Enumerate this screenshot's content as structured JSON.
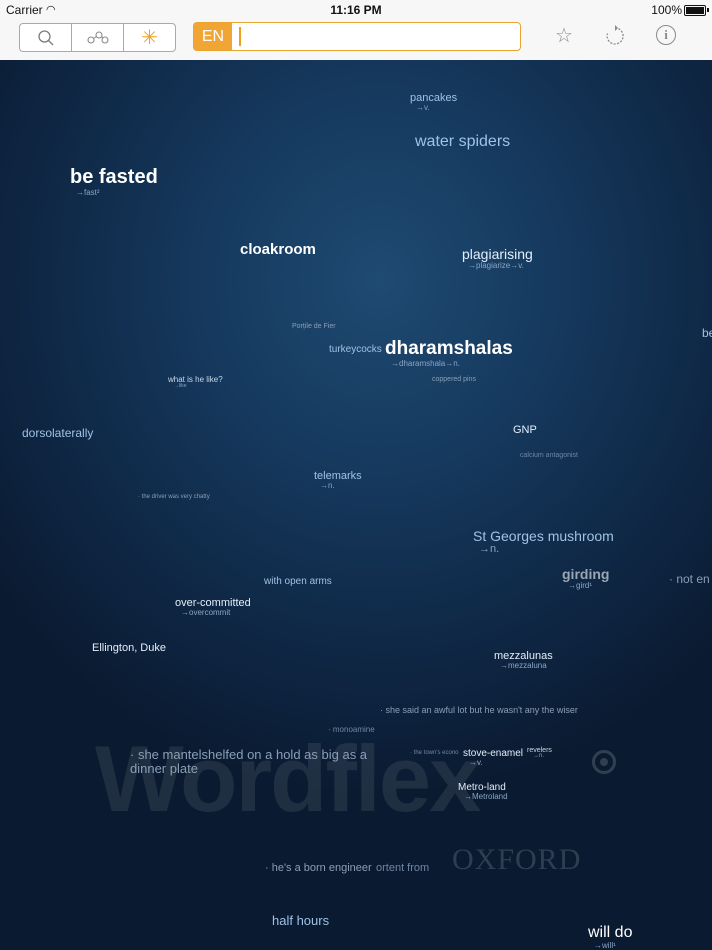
{
  "status_bar": {
    "carrier": "Carrier",
    "time": "11:16 PM",
    "battery": "100%"
  },
  "toolbar": {
    "language": "EN",
    "search_value": "",
    "icons": [
      "search-icon",
      "network-icon",
      "asterisk-icon",
      "star-icon",
      "refresh-icon",
      "info-icon"
    ],
    "accent_color": "#f0a535"
  },
  "word_cloud": {
    "words": [
      {
        "text": "pancakes",
        "sub": "→v."
      },
      {
        "text": "water spiders",
        "sub": ""
      },
      {
        "text": "be fasted",
        "sub": "→fast²"
      },
      {
        "text": "cloakroom",
        "sub": ""
      },
      {
        "text": "plagiarising",
        "sub": "→plagiarize→v."
      },
      {
        "text": "Porțile de Fier",
        "sub": ""
      },
      {
        "text": "turkeycocks",
        "sub": ""
      },
      {
        "text": "dharamshalas",
        "sub": "→dharamshala→n."
      },
      {
        "text": "be",
        "sub": ""
      },
      {
        "text": "what is he like?",
        "sub": "→like"
      },
      {
        "text": "coppered pins",
        "sub": ""
      },
      {
        "text": "dorsolaterally",
        "sub": ""
      },
      {
        "text": "GNP",
        "sub": ""
      },
      {
        "text": "calcium antagonist",
        "sub": ""
      },
      {
        "text": "telemarks",
        "sub": "→n."
      },
      {
        "text": "· the driver was very chatty",
        "sub": ""
      },
      {
        "text": "St Georges mushroom",
        "sub": "→n."
      },
      {
        "text": "girding",
        "sub": "→gird¹"
      },
      {
        "text": "· not en",
        "sub": ""
      },
      {
        "text": "with open arms",
        "sub": ""
      },
      {
        "text": "over-committed",
        "sub": "→overcommit"
      },
      {
        "text": "Ellington, Duke",
        "sub": ""
      },
      {
        "text": "mezzalunas",
        "sub": "→mezzaluna"
      },
      {
        "text": "· she said an awful lot but he wasn't any the wiser",
        "sub": ""
      },
      {
        "text": "· monoamine",
        "sub": ""
      },
      {
        "text": "· she mantelshelfed on a hold as big as a dinner plate",
        "sub": ""
      },
      {
        "text": "· the town's econo",
        "sub": ""
      },
      {
        "text": "stove-enamel",
        "sub": "→v."
      },
      {
        "text": "revelers",
        "sub": "→n."
      },
      {
        "text": "Metro-land",
        "sub": "→Metroland"
      },
      {
        "text": "· he's a born engineer",
        "sub": ""
      },
      {
        "text": "ortent from",
        "sub": ""
      },
      {
        "text": "half hours",
        "sub": ""
      },
      {
        "text": "will do",
        "sub": "→will¹"
      }
    ],
    "watermark": {
      "brand": "Wordflex",
      "publisher": "OXFORD"
    }
  }
}
